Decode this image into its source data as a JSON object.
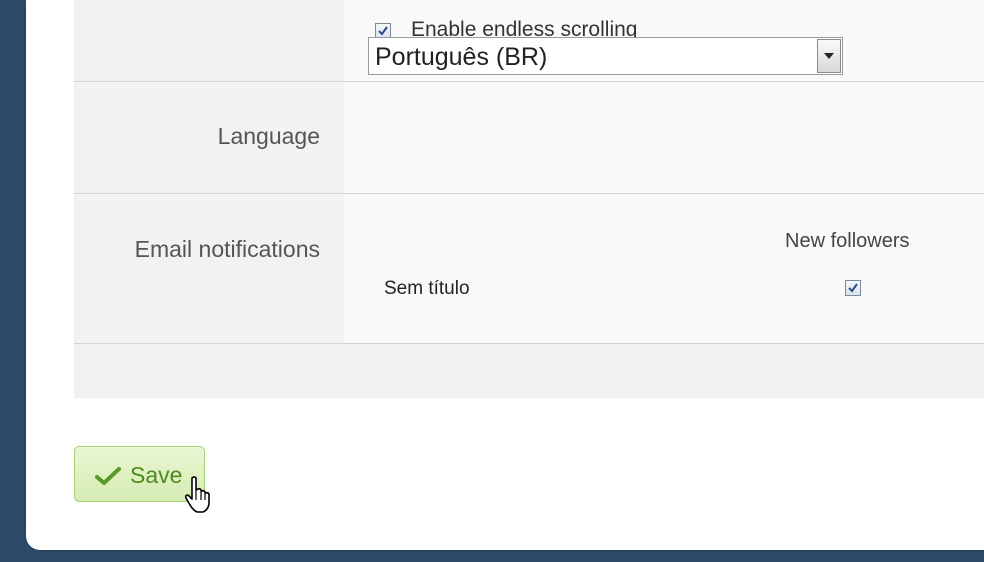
{
  "preferences": {
    "endless_scrolling": {
      "label": "Enable endless scrolling",
      "checked": true
    },
    "language": {
      "label": "Language",
      "selected": "Português (BR)"
    },
    "email_notifications": {
      "label": "Email notifications",
      "columns": [
        "New followers"
      ],
      "rows": [
        {
          "name": "Sem título",
          "new_followers": true
        }
      ]
    }
  },
  "actions": {
    "save_label": "Save"
  },
  "icons": {
    "save": "checkmark-icon",
    "dropdown": "triangle-down-icon",
    "cursor": "hand-pointer-icon"
  },
  "colors": {
    "background": "#2b4a68",
    "save_text": "#4f8a1c",
    "save_bg": "#d5ecb2"
  }
}
